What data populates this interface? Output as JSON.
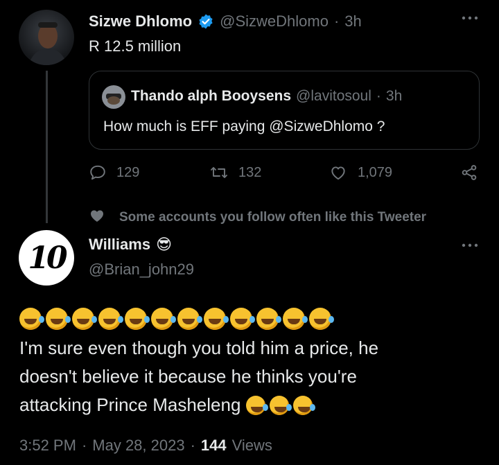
{
  "main_tweet": {
    "author_name": "Sizwe Dhlomo",
    "handle": "@SizweDhlomo",
    "separator": "·",
    "time": "3h",
    "text": "R 12.5 million",
    "quoted": {
      "author_name": "Thando alph Booysens",
      "handle": "@lavitosoul",
      "time": "3h",
      "text": "How much is EFF paying @SizweDhlomo ?"
    },
    "actions": {
      "replies": "129",
      "retweets": "132",
      "likes": "1,079"
    }
  },
  "social_context": "Some accounts you follow often like this Tweeter",
  "reply": {
    "author_name": "Williams",
    "author_emoji": "😎",
    "handle": "@Brian_john29",
    "avatar_text": "10",
    "text_line1": "I'm sure even though you told him a price, he",
    "text_line2": "doesn't believe it because he thinks you're",
    "text_line3": "attacking Prince Masheleng",
    "footer_time": "3:52 PM",
    "footer_date": "May 28, 2023",
    "views_count": "144",
    "views_label": "Views"
  },
  "colors": {
    "background": "#000000",
    "text": "#e7e9ea",
    "muted": "#71767b",
    "verified": "#1d9bf0"
  },
  "icons": [
    "verified-badge-icon",
    "more-icon",
    "reply-icon",
    "retweet-icon",
    "like-icon",
    "share-icon",
    "heart-social-icon",
    "rolling-laughing-emoji"
  ]
}
